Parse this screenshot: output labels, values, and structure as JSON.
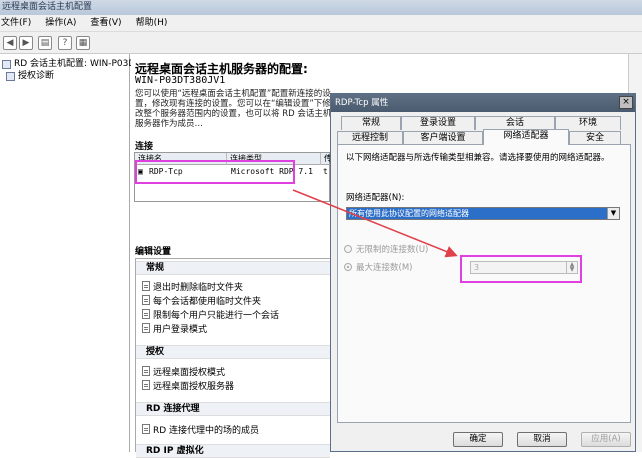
{
  "window": {
    "title": "远程桌面会话主机配置"
  },
  "menu": {
    "file": "文件(F)",
    "action": "操作(A)",
    "view": "查看(V)",
    "help": "帮助(H)"
  },
  "tree": {
    "root": "RD 会话主机配置: WIN-P03D",
    "child": "授权诊断"
  },
  "main": {
    "title": "远程桌面会话主机服务器的配置:",
    "server_name": "WIN-P03DT380JV1",
    "description": "您可以使用“远程桌面会话主机配置”配置新连接的设置，修改现有连接的设置。您可以在“编辑设置”下修改整个服务器范围内的设置，也可以将 RD 会话主机服务器作为成员…",
    "connections_heading": "连接",
    "table": {
      "col_name": "连接名",
      "col_type": "连接类型",
      "col_extra": "传",
      "row_name": "RDP-Tcp",
      "row_type": "Microsoft RDP 7.1",
      "row_extra": "t"
    },
    "edit_heading": "编辑设置",
    "sections": [
      {
        "title": "常规",
        "items": [
          "退出时删除临时文件夹",
          "每个会话都使用临时文件夹",
          "限制每个用户只能进行一个会话",
          "用户登录模式"
        ]
      },
      {
        "title": "授权",
        "items": [
          "远程桌面授权模式",
          "远程桌面授权服务器"
        ]
      },
      {
        "title": "RD 连接代理",
        "items": [
          "RD 连接代理中的场的成员"
        ]
      },
      {
        "title": "RD IP 虚拟化",
        "items": []
      }
    ]
  },
  "dialog": {
    "title": "RDP-Tcp 属性",
    "close": "×",
    "tabs_row1": [
      "常规",
      "登录设置",
      "会话",
      "环境"
    ],
    "tabs_row2": [
      "远程控制",
      "客户端设置",
      "网络适配器",
      "安全"
    ],
    "description": "以下网络适配器与所选传输类型相兼容。请选择要使用的网络适配器。",
    "adapter_label": "网络适配器(N):",
    "adapter_value": "所有使用此协议配置的网络适配器",
    "radio_unlimited": "无限制的连接数(U)",
    "radio_max": "最大连接数(M)",
    "max_value": "3",
    "buttons": {
      "ok": "确定",
      "cancel": "取消",
      "apply": "应用(A)"
    }
  },
  "colors": {
    "highlight": "#e040e0",
    "arrow": "#e0404a",
    "selection": "#2c6fc9"
  }
}
